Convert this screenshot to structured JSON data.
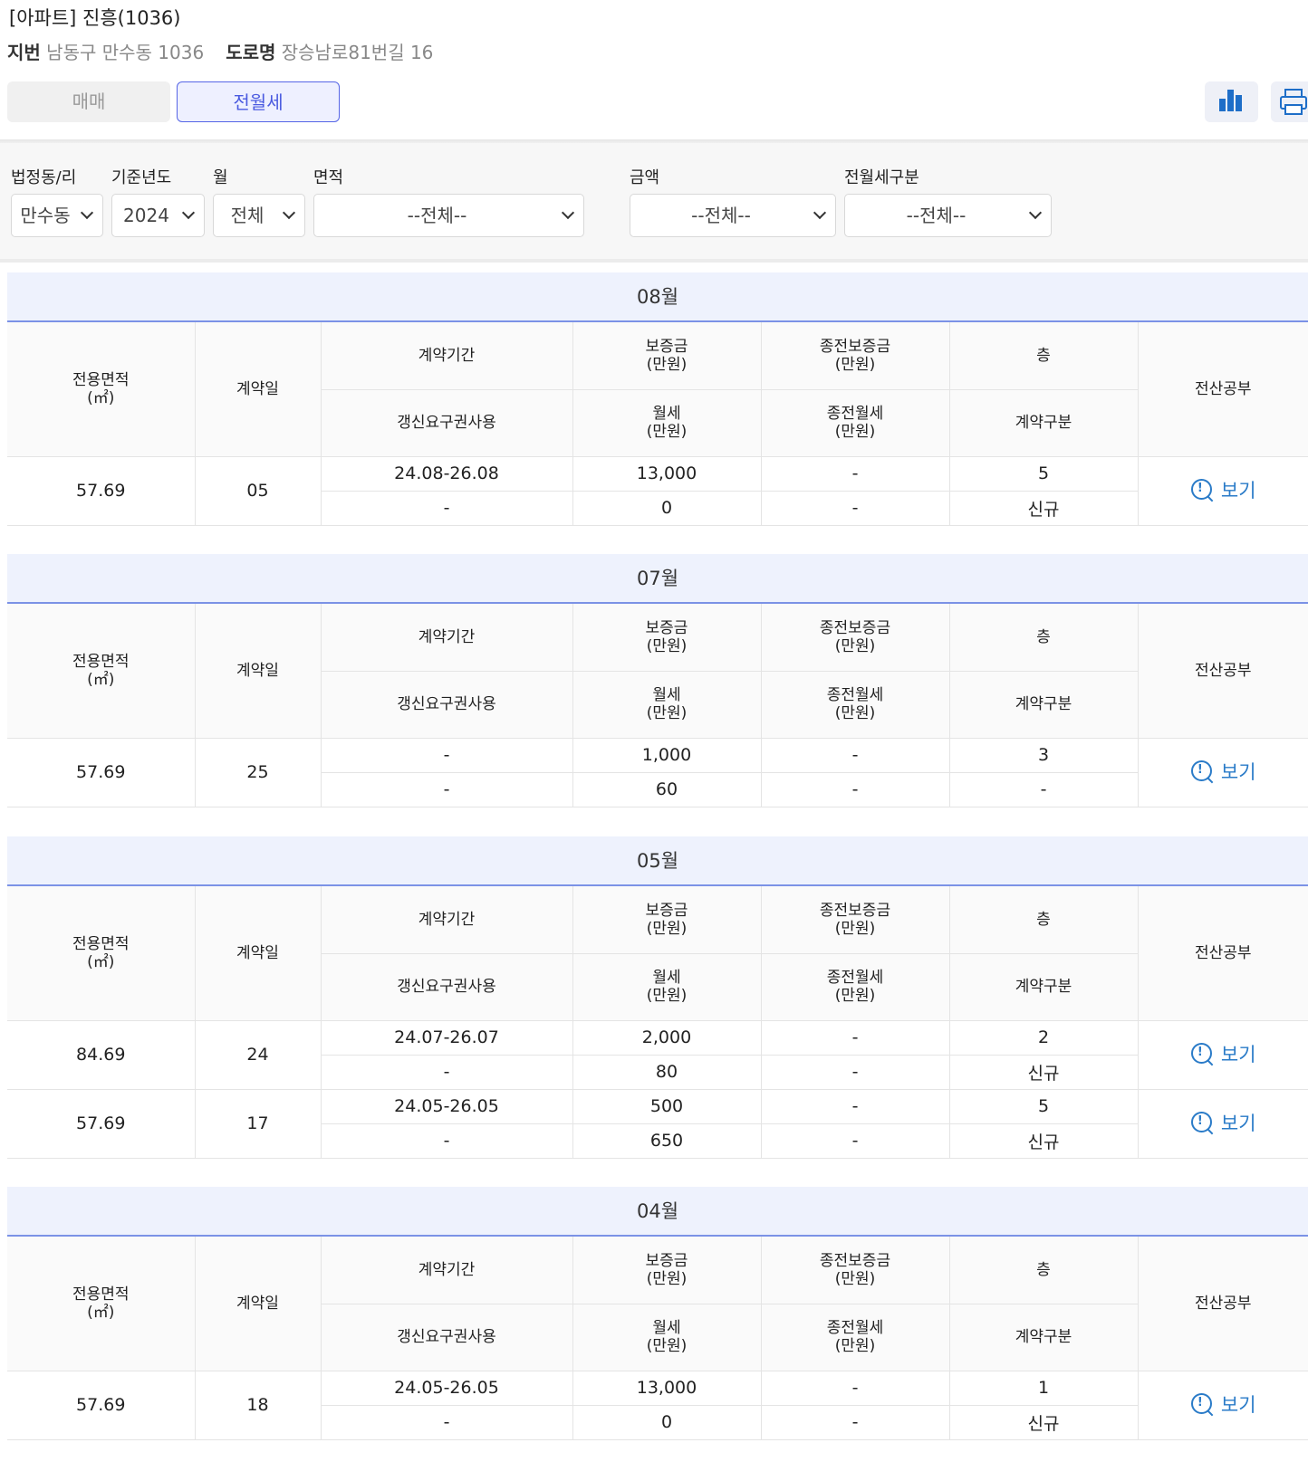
{
  "header": {
    "title": "[아파트] 진흥(1036)",
    "jibun_label": "지번",
    "jibun_value": "남동구 만수동 1036",
    "road_label": "도로명",
    "road_value": "장승남로81번길 16"
  },
  "tabs": [
    {
      "label": "매매",
      "active": false
    },
    {
      "label": "전월세",
      "active": true
    }
  ],
  "toolbar": {
    "chart_icon": "bar-chart-icon",
    "print_icon": "print-icon"
  },
  "filters": {
    "dong": {
      "label": "법정동/리",
      "value": "만수동"
    },
    "year": {
      "label": "기준년도",
      "value": "2024"
    },
    "month": {
      "label": "월",
      "value": "전체"
    },
    "area": {
      "label": "면적",
      "value": "--전체--"
    },
    "amount": {
      "label": "금액",
      "value": "--전체--"
    },
    "rent_type": {
      "label": "전월세구분",
      "value": "--전체--"
    }
  },
  "columns": {
    "area": "전용면적\n(㎡)",
    "date": "계약일",
    "period": "계약기간",
    "deposit": "보증금\n(만원)",
    "prev_deposit": "종전보증금\n(만원)",
    "floor": "층",
    "renew": "갱신요구권사용",
    "rent": "월세\n(만원)",
    "prev_rent": "종전월세\n(만원)",
    "contract_type": "계약구분",
    "registry": "전산공부"
  },
  "view_label": "보기",
  "months": [
    {
      "month": "08월",
      "rows": [
        {
          "area": "57.69",
          "day": "05",
          "period": "24.08-26.08",
          "deposit": "13,000",
          "prev_deposit": "-",
          "floor": "5",
          "renew": "-",
          "rent": "0",
          "prev_rent": "-",
          "type": "신규"
        }
      ]
    },
    {
      "month": "07월",
      "rows": [
        {
          "area": "57.69",
          "day": "25",
          "period": "-",
          "deposit": "1,000",
          "prev_deposit": "-",
          "floor": "3",
          "renew": "-",
          "rent": "60",
          "prev_rent": "-",
          "type": "-"
        }
      ]
    },
    {
      "month": "05월",
      "rows": [
        {
          "area": "84.69",
          "day": "24",
          "period": "24.07-26.07",
          "deposit": "2,000",
          "prev_deposit": "-",
          "floor": "2",
          "renew": "-",
          "rent": "80",
          "prev_rent": "-",
          "type": "신규"
        },
        {
          "area": "57.69",
          "day": "17",
          "period": "24.05-26.05",
          "deposit": "500",
          "prev_deposit": "-",
          "floor": "5",
          "renew": "-",
          "rent": "650",
          "prev_rent": "-",
          "type": "신규"
        }
      ]
    },
    {
      "month": "04월",
      "rows": [
        {
          "area": "57.69",
          "day": "18",
          "period": "24.05-26.05",
          "deposit": "13,000",
          "prev_deposit": "-",
          "floor": "1",
          "renew": "-",
          "rent": "0",
          "prev_rent": "-",
          "type": "신규"
        }
      ]
    }
  ]
}
